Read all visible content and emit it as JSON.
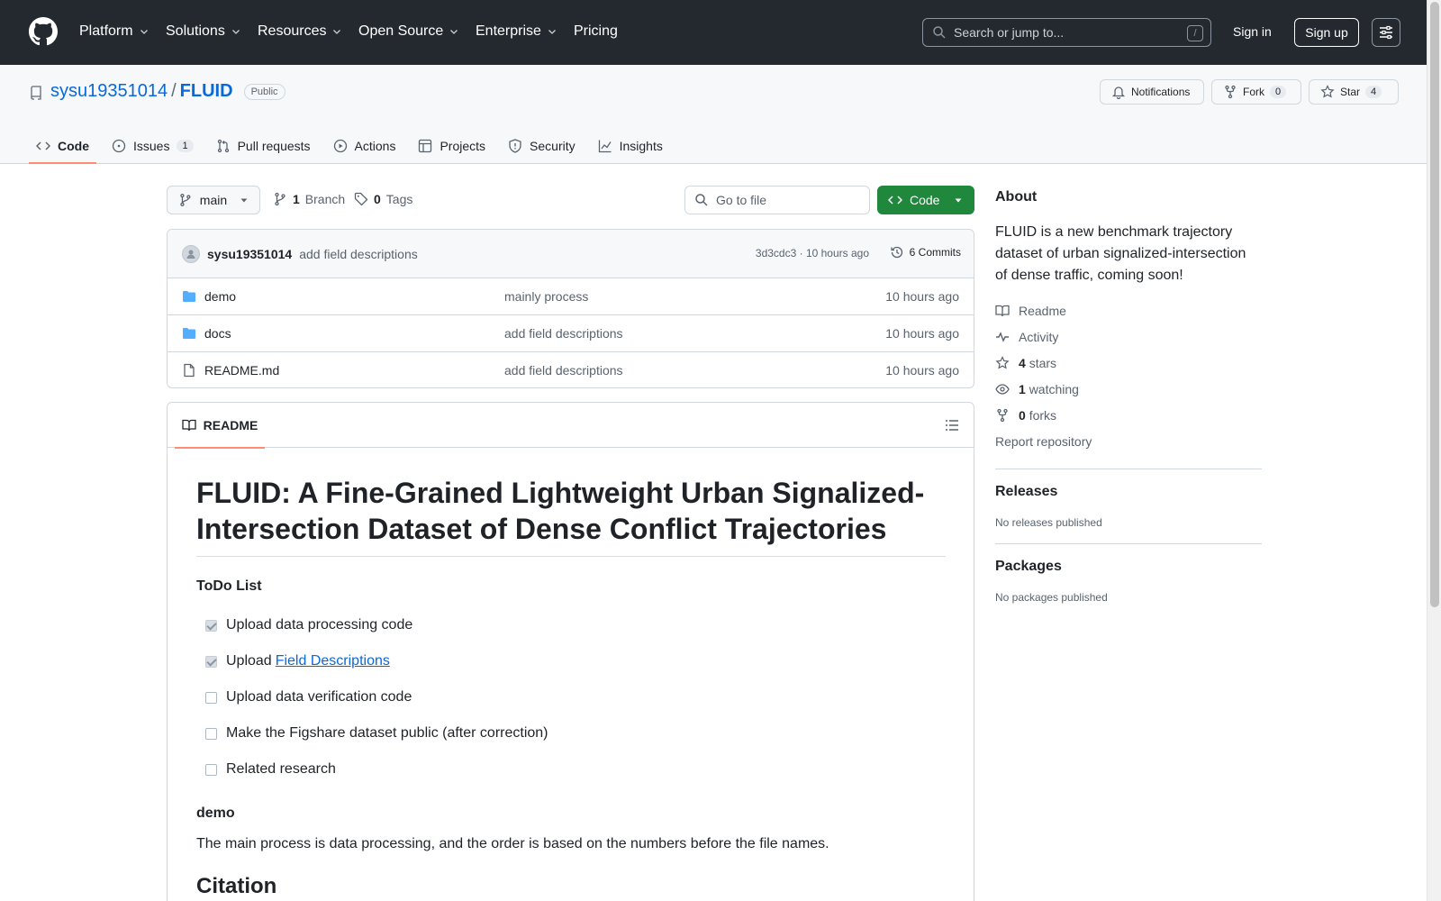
{
  "header": {
    "nav": [
      {
        "label": "Platform",
        "dropdown": true
      },
      {
        "label": "Solutions",
        "dropdown": true
      },
      {
        "label": "Resources",
        "dropdown": true
      },
      {
        "label": "Open Source",
        "dropdown": true
      },
      {
        "label": "Enterprise",
        "dropdown": true
      },
      {
        "label": "Pricing",
        "dropdown": false
      }
    ],
    "search_placeholder": "Search or jump to...",
    "search_shortcut": "/",
    "sign_in": "Sign in",
    "sign_up": "Sign up"
  },
  "repo": {
    "owner": "sysu19351014",
    "separator": "/",
    "name": "FLUID",
    "visibility": "Public",
    "notifications_label": "Notifications",
    "fork_label": "Fork",
    "fork_count": "0",
    "star_label": "Star",
    "star_count": "4"
  },
  "tabs": [
    {
      "label": "Code",
      "icon": "code-icon",
      "active": true,
      "count": ""
    },
    {
      "label": "Issues",
      "icon": "issue-icon",
      "active": false,
      "count": "1"
    },
    {
      "label": "Pull requests",
      "icon": "pull-request-icon",
      "active": false,
      "count": ""
    },
    {
      "label": "Actions",
      "icon": "play-icon",
      "active": false,
      "count": ""
    },
    {
      "label": "Projects",
      "icon": "table-icon",
      "active": false,
      "count": ""
    },
    {
      "label": "Security",
      "icon": "shield-icon",
      "active": false,
      "count": ""
    },
    {
      "label": "Insights",
      "icon": "graph-icon",
      "active": false,
      "count": ""
    }
  ],
  "toolbar": {
    "branch": "main",
    "branch_count": "1",
    "branch_label": "Branch",
    "tag_count": "0",
    "tag_label": "Tags",
    "goto_placeholder": "Go to file",
    "code_label": "Code"
  },
  "commit": {
    "user": "sysu19351014",
    "message": "add field descriptions",
    "meta": "3d3cdc3 · 10 hours ago",
    "commits_label": "6 Commits"
  },
  "files": [
    {
      "name": "demo",
      "type": "folder",
      "message": "mainly process",
      "time": "10 hours ago"
    },
    {
      "name": "docs",
      "type": "folder",
      "message": "add field descriptions",
      "time": "10 hours ago"
    },
    {
      "name": "README.md",
      "type": "file",
      "message": "add field descriptions",
      "time": "10 hours ago"
    }
  ],
  "readme": {
    "tab_label": "README",
    "title_line1": "FLUID: A Fine-Grained Lightweight Urban Signalized-",
    "title_line2": "Intersection Dataset of Dense Conflict Trajectories",
    "todo_heading": "ToDo List",
    "todo": [
      {
        "text": "Upload data processing code",
        "checked": true,
        "link": ""
      },
      {
        "text": "Upload",
        "checked": true,
        "link": "Field Descriptions"
      },
      {
        "text": "Upload data verification code",
        "checked": false,
        "link": ""
      },
      {
        "text": "Make the Figshare dataset public (after correction)",
        "checked": false,
        "link": ""
      },
      {
        "text": "Related research",
        "checked": false,
        "link": ""
      }
    ],
    "demo_heading": "demo",
    "demo_text": "The main process is data processing, and the order is based on the numbers before the file names.",
    "citation_heading": "Citation"
  },
  "about": {
    "heading": "About",
    "description": "FLUID is a new benchmark trajectory dataset of urban signalized-intersection of dense traffic, coming soon!",
    "links": [
      {
        "icon": "book-icon",
        "bold": "",
        "label": "Readme"
      },
      {
        "icon": "pulse-icon",
        "bold": "",
        "label": "Activity"
      },
      {
        "icon": "star-icon",
        "bold": "4",
        "label": "stars"
      },
      {
        "icon": "eye-icon",
        "bold": "1",
        "label": "watching"
      },
      {
        "icon": "fork-icon",
        "bold": "0",
        "label": "forks"
      }
    ],
    "report": "Report repository",
    "releases_heading": "Releases",
    "releases_text": "No releases published",
    "packages_heading": "Packages",
    "packages_text": "No packages published"
  },
  "colors": {
    "header_bg": "#24292f",
    "link": "#0969da",
    "primary_button": "#1f883d",
    "active_tab_underline": "#fd8c73",
    "folder": "#54aeff"
  }
}
